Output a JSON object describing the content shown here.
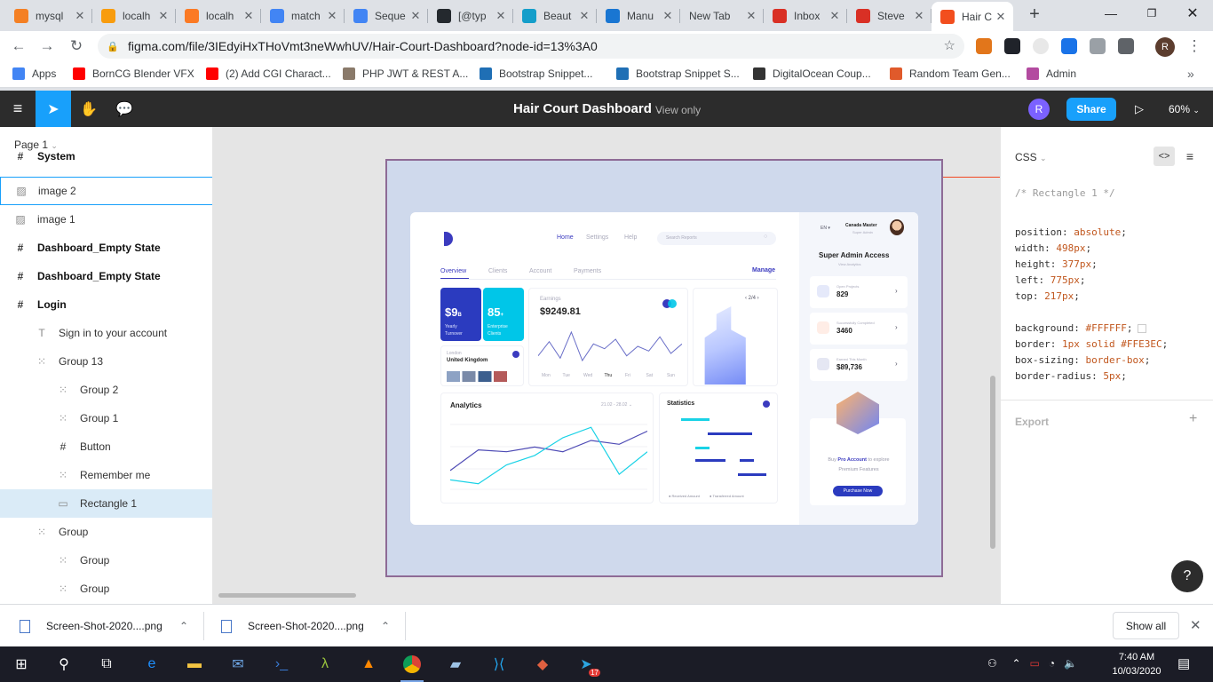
{
  "browser": {
    "tabs": [
      {
        "title": "mysql",
        "icon": "stack-overflow-icon",
        "color": "#f48024"
      },
      {
        "title": "localh",
        "icon": "phpmyadmin-icon",
        "color": "#f89c0e"
      },
      {
        "title": "localh",
        "icon": "xampp-icon",
        "color": "#fb7a24"
      },
      {
        "title": "match",
        "icon": "google-icon",
        "color": "#4285f4"
      },
      {
        "title": "Seque",
        "icon": "google-icon",
        "color": "#4285f4"
      },
      {
        "title": "[@typ",
        "icon": "github-icon",
        "color": "#24292e"
      },
      {
        "title": "Beaut",
        "icon": "react-icon",
        "color": "#149eca"
      },
      {
        "title": "Manu",
        "icon": "cube-icon",
        "color": "#1976d2"
      },
      {
        "title": "New Tab",
        "icon": "",
        "color": ""
      },
      {
        "title": "Inbox",
        "icon": "gmail-icon",
        "color": "#d93025"
      },
      {
        "title": "Steve",
        "icon": "gmail-icon",
        "color": "#d93025"
      },
      {
        "title": "Hair C",
        "icon": "figma-icon",
        "color": "#f24e1e",
        "active": true
      }
    ],
    "new_tab": "+",
    "url": "figma.com/file/3IEdyiHxTHoVmt3neWwhUV/Hair-Court-Dashboard?node-id=13%3A0",
    "profile_initial": "R",
    "bookmarks": [
      {
        "label": "Apps",
        "icon": "apps-grid-icon",
        "color": "#4285f4"
      },
      {
        "label": "BornCG Blender VFX",
        "icon": "youtube-icon",
        "color": "#ff0000"
      },
      {
        "label": "(2) Add CGI Charact...",
        "icon": "youtube-icon",
        "color": "#ff0000"
      },
      {
        "label": "PHP JWT & REST A...",
        "icon": "php-icon",
        "color": "#8a7a6a"
      },
      {
        "label": "Bootstrap Snippet...",
        "icon": "bootstrap-icon",
        "color": "#1f6fb5"
      },
      {
        "label": "Bootstrap Snippet S...",
        "icon": "bootstrap-icon",
        "color": "#1f6fb5"
      },
      {
        "label": "DigitalOcean Coup...",
        "icon": "v-icon",
        "color": "#333333"
      },
      {
        "label": "Random Team Gen...",
        "icon": "grid-icon",
        "color": "#e05a2b"
      },
      {
        "label": "Admin",
        "icon": "admin-icon",
        "color": "#b34ba0"
      }
    ],
    "more_bookmarks": "»"
  },
  "figma": {
    "file_title": "Hair Court Dashboard",
    "view_mode": "View only",
    "avatar_initial": "R",
    "share_label": "Share",
    "zoom": "60%",
    "page": "Page 1",
    "layers": [
      {
        "label": "System",
        "type": "frame",
        "bold": true,
        "indent": 0
      },
      {
        "label": "image 2",
        "type": "image",
        "bold": false,
        "indent": 0,
        "hover": true
      },
      {
        "label": "image 1",
        "type": "image",
        "bold": false,
        "indent": 0
      },
      {
        "label": "Dashboard_Empty State",
        "type": "frame",
        "bold": true,
        "indent": 0
      },
      {
        "label": "Dashboard_Empty State",
        "type": "frame",
        "bold": true,
        "indent": 0
      },
      {
        "label": "Login",
        "type": "frame",
        "bold": true,
        "indent": 0
      },
      {
        "label": "Sign in to your account",
        "type": "text",
        "bold": false,
        "indent": 1
      },
      {
        "label": "Group 13",
        "type": "group",
        "bold": false,
        "indent": 1
      },
      {
        "label": "Group 2",
        "type": "group",
        "bold": false,
        "indent": 2
      },
      {
        "label": "Group 1",
        "type": "group",
        "bold": false,
        "indent": 2
      },
      {
        "label": "Button",
        "type": "frame",
        "bold": false,
        "indent": 2
      },
      {
        "label": "Remember me",
        "type": "group",
        "bold": false,
        "indent": 2
      },
      {
        "label": "Rectangle 1",
        "type": "rect",
        "bold": false,
        "indent": 2,
        "selected": true
      },
      {
        "label": "Group",
        "type": "group",
        "bold": false,
        "indent": 1
      },
      {
        "label": "Group",
        "type": "group",
        "bold": false,
        "indent": 2
      },
      {
        "label": "Group",
        "type": "group",
        "bold": false,
        "indent": 2
      }
    ],
    "css_panel": {
      "header": "CSS",
      "comment": "/* Rectangle 1 */",
      "lines": [
        {
          "prop": "position",
          "value": "absolute"
        },
        {
          "prop": "width",
          "value": "498px"
        },
        {
          "prop": "height",
          "value": "377px"
        },
        {
          "prop": "left",
          "value": "775px"
        },
        {
          "prop": "top",
          "value": "217px"
        },
        {
          "prop": "",
          "value": ""
        },
        {
          "prop": "background",
          "value": "#FFFFFF"
        },
        {
          "prop": "border",
          "value": "1px solid #FFE3EC"
        },
        {
          "prop": "box-sizing",
          "value": "border-box"
        },
        {
          "prop": "border-radius",
          "value": "5px"
        }
      ],
      "export_label": "Export",
      "help": "?"
    }
  },
  "dashboard": {
    "nav": [
      "Home",
      "Settings",
      "Help"
    ],
    "search_placeholder": "Search Reports",
    "tabs": [
      "Overview",
      "Clients",
      "Account",
      "Payments"
    ],
    "manage": "Manage",
    "turnover": {
      "value": "$9",
      "unit": "B",
      "label": "Yearly Turnover"
    },
    "clients": {
      "value": "85",
      "unit": "+",
      "label": "Enterprise Clients"
    },
    "location": {
      "city": "London",
      "country": "United Kingdom"
    },
    "earnings": {
      "label": "Earnings",
      "value": "$9249.81",
      "days": [
        "Mon",
        "Tue",
        "Wed",
        "Thu",
        "Fri",
        "Sat",
        "Sun"
      ],
      "values": [
        30,
        42,
        28,
        50,
        26,
        40,
        36,
        44,
        30,
        38,
        34,
        46,
        32,
        40
      ]
    },
    "pager": "2/4",
    "analytics": {
      "title": "Analytics",
      "range": "21.02 - 28.02",
      "series_a": [
        20,
        42,
        40,
        45,
        40,
        52,
        48,
        62
      ],
      "series_b": [
        10,
        6,
        26,
        36,
        55,
        66,
        16,
        40
      ]
    },
    "statistics": {
      "title": "Statistics",
      "legend": [
        "Received Amount",
        "Transferred Amount"
      ]
    },
    "sidebar": {
      "lang": "EN",
      "user_name": "Canada Master",
      "user_role": "Super Admin",
      "heading": "Super Admin Access",
      "sub": "View Analytics",
      "stats": [
        {
          "label": "Open Projects",
          "value": "829",
          "color": "#3b5bdb"
        },
        {
          "label": "Successfully Completed",
          "value": "3460",
          "color": "#ff7a45"
        },
        {
          "label": "Earned This Month",
          "value": "$89,736",
          "color": "#3b4ba8"
        }
      ],
      "promo_prefix": "Buy ",
      "promo_link": "Pro Account",
      "promo_suffix": " to explore Premium Features",
      "promo_button": "Purchase Now"
    }
  },
  "downloads": [
    {
      "name": "Screen-Shot-2020....png"
    },
    {
      "name": "Screen-Shot-2020....png"
    }
  ],
  "show_all": "Show all",
  "taskbar": {
    "time": "7:40 AM",
    "date": "10/03/2020",
    "badge": "17"
  }
}
